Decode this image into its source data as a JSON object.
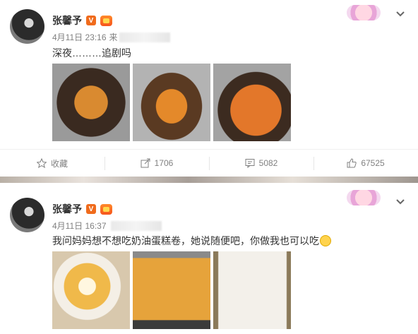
{
  "posts": [
    {
      "username": "张馨予",
      "verified_badge": "V",
      "date": "4月11日 23:16",
      "source_prefix": "来",
      "text": "深夜………追剧吗",
      "images": [
        "noodle-bowl-1",
        "noodle-bowl-2",
        "noodle-bowl-3"
      ],
      "actions": {
        "favorite_label": "收藏",
        "repost_count": "1706",
        "comment_count": "5082",
        "like_count": "67525"
      }
    },
    {
      "username": "张馨予",
      "verified_badge": "V",
      "date": "4月11日 16:37",
      "text": "我问妈妈想不想吃奶油蛋糕卷，她说随便吧，你做我也可以吃",
      "images": [
        "cake-roll",
        "cake-sheet-oven",
        "cake-cream-spread"
      ]
    }
  ],
  "icons": {
    "favorite": "star-icon",
    "repost": "share-icon",
    "comment": "comment-icon",
    "like": "thumbs-up-icon",
    "menu": "chevron-down-icon"
  },
  "colors": {
    "verified": "#f06b1c",
    "text_muted": "#808080"
  }
}
